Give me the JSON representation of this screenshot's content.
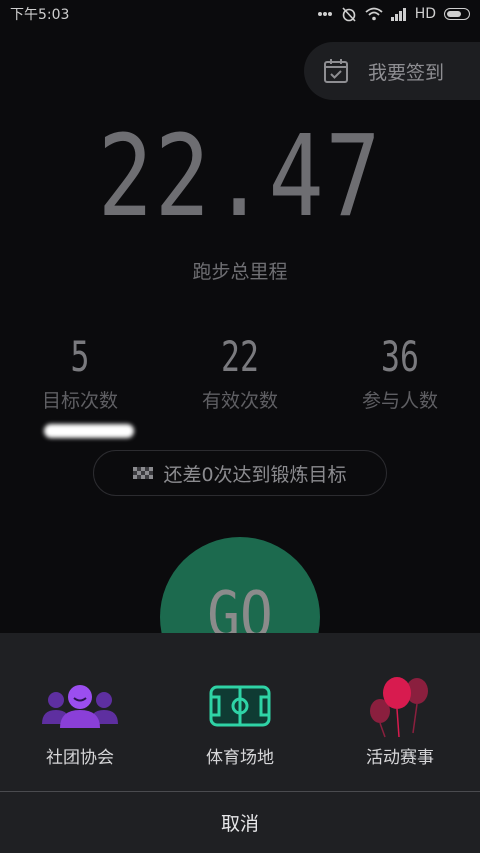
{
  "status_bar": {
    "time": "下午5:03",
    "network_label": "HD",
    "icons": [
      "more-dots-icon",
      "alarm-off-icon",
      "wifi-icon",
      "signal-icon",
      "battery-icon"
    ]
  },
  "signin": {
    "label": "我要签到",
    "icon": "calendar-check-icon"
  },
  "mileage": {
    "value": "22.47",
    "label": "跑步总里程"
  },
  "stats": [
    {
      "value": "5",
      "label": "目标次数"
    },
    {
      "value": "22",
      "label": "有效次数"
    },
    {
      "value": "36",
      "label": "参与人数"
    }
  ],
  "goal_message": {
    "text": "还差0次达到锻炼目标",
    "icon": "checkered-flag-icon"
  },
  "go_button": {
    "label": "GO",
    "color": "#1c6a4e"
  },
  "sheet": {
    "items": [
      {
        "label": "社团协会",
        "icon": "group-icon",
        "color": "#8a3fd8"
      },
      {
        "label": "体育场地",
        "icon": "field-icon",
        "color": "#2fd3a6"
      },
      {
        "label": "活动赛事",
        "icon": "balloons-icon",
        "color": "#d81b4f"
      }
    ],
    "cancel_label": "取消"
  }
}
